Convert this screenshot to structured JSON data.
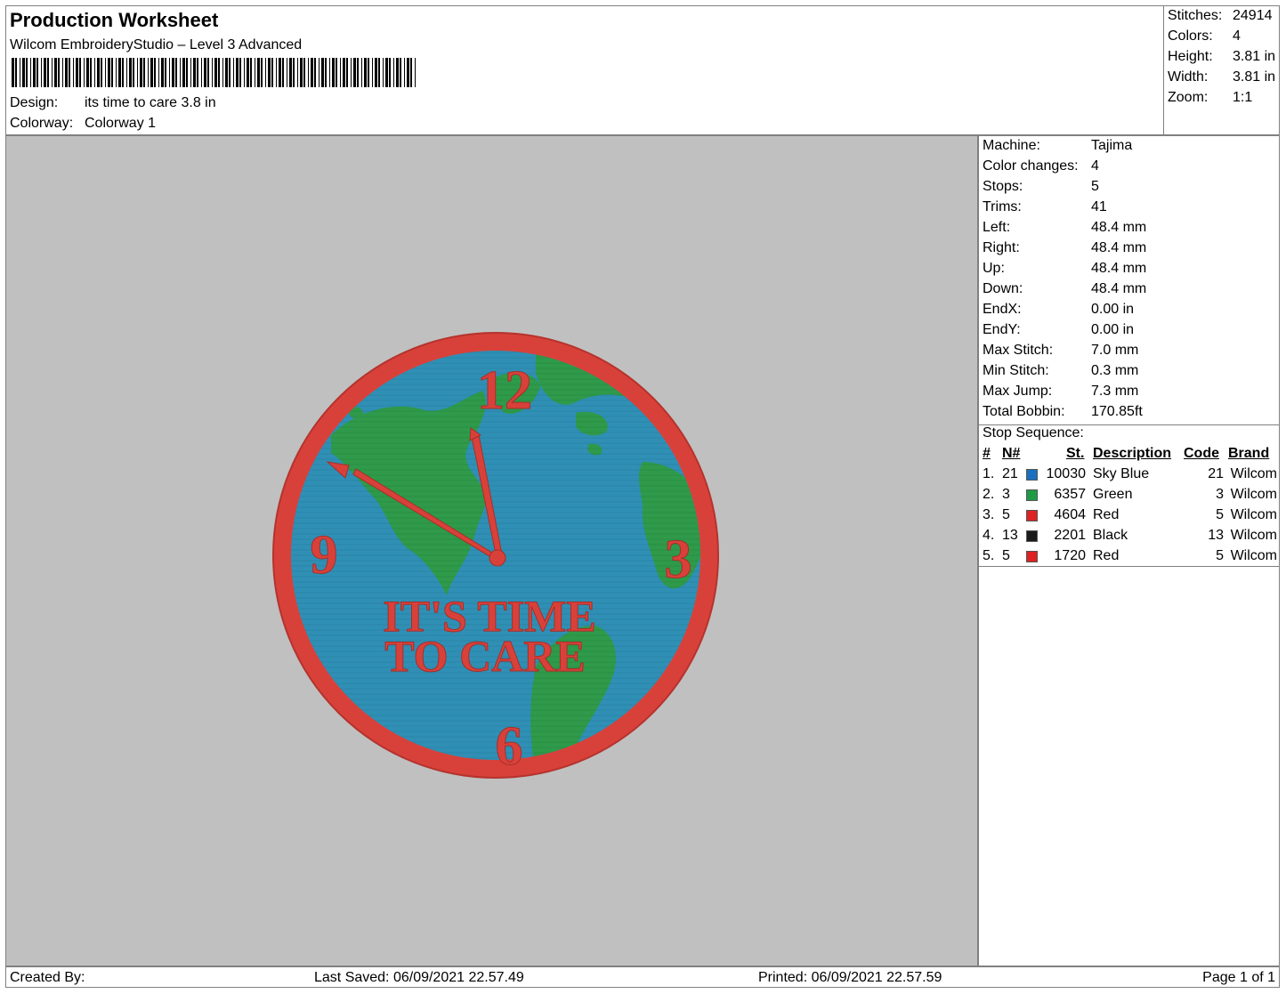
{
  "header": {
    "title": "Production Worksheet",
    "subtitle": "Wilcom EmbroideryStudio – Level 3 Advanced",
    "design_label": "Design:",
    "design_value": "its time to care 3.8 in",
    "colorway_label": "Colorway:",
    "colorway_value": "Colorway 1"
  },
  "stats": [
    {
      "label": "Stitches:",
      "value": "24914"
    },
    {
      "label": "Colors:",
      "value": "4"
    },
    {
      "label": "Height:",
      "value": "3.81 in"
    },
    {
      "label": "Width:",
      "value": "3.81 in"
    },
    {
      "label": "Zoom:",
      "value": "1:1"
    }
  ],
  "machine_info": [
    {
      "label": "Machine:",
      "value": "Tajima"
    },
    {
      "label": "Color changes:",
      "value": "4"
    },
    {
      "label": "Stops:",
      "value": "5"
    },
    {
      "label": "Trims:",
      "value": "41"
    },
    {
      "label": "Left:",
      "value": "48.4 mm"
    },
    {
      "label": "Right:",
      "value": "48.4 mm"
    },
    {
      "label": "Up:",
      "value": "48.4 mm"
    },
    {
      "label": "Down:",
      "value": "48.4 mm"
    },
    {
      "label": "EndX:",
      "value": "0.00 in"
    },
    {
      "label": "EndY:",
      "value": "0.00 in"
    },
    {
      "label": "Max Stitch:",
      "value": "7.0 mm"
    },
    {
      "label": "Min Stitch:",
      "value": "0.3 mm"
    },
    {
      "label": "Max Jump:",
      "value": "7.3 mm"
    },
    {
      "label": "Total Bobbin:",
      "value": "170.85ft"
    }
  ],
  "stop_sequence": {
    "label": "Stop Sequence:",
    "columns": [
      "#",
      "N#",
      "St.",
      "Description",
      "Code",
      "Brand"
    ],
    "rows": [
      {
        "num": "1.",
        "needle": "21",
        "color": "#1a6fc0",
        "stitches": "10030",
        "description": "Sky Blue",
        "code": "21",
        "brand": "Wilcom"
      },
      {
        "num": "2.",
        "needle": "3",
        "color": "#1f9a45",
        "stitches": "6357",
        "description": "Green",
        "code": "3",
        "brand": "Wilcom"
      },
      {
        "num": "3.",
        "needle": "5",
        "color": "#dd2222",
        "stitches": "4604",
        "description": "Red",
        "code": "5",
        "brand": "Wilcom"
      },
      {
        "num": "4.",
        "needle": "13",
        "color": "#1a1a1a",
        "stitches": "2201",
        "description": "Black",
        "code": "13",
        "brand": "Wilcom"
      },
      {
        "num": "5.",
        "needle": "5",
        "color": "#dd2222",
        "stitches": "1720",
        "description": "Red",
        "code": "5",
        "brand": "Wilcom"
      }
    ]
  },
  "design_art": {
    "numeral_12": "12",
    "numeral_3": "3",
    "numeral_6": "6",
    "numeral_9": "9",
    "text_line1": "IT'S TIME",
    "text_line2": "TO CARE",
    "colors": {
      "ocean": "#2f8fb5",
      "land": "#2e9a4a",
      "border": "#d8413a",
      "canvas": "#c0c0c0"
    }
  },
  "footer": {
    "created_by": "Created By:",
    "last_saved": "Last Saved: 06/09/2021 22.57.49",
    "printed": "Printed: 06/09/2021 22.57.59",
    "page": "Page 1 of 1"
  }
}
